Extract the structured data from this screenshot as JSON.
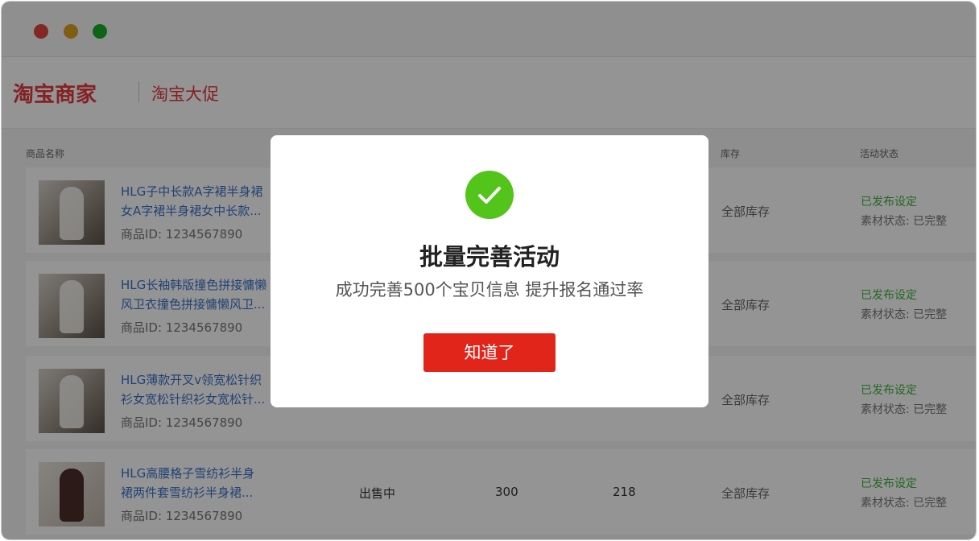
{
  "window": {
    "controls": [
      "close",
      "minimize",
      "maximize"
    ]
  },
  "brand": {
    "logo": "淘宝商家",
    "sub": "淘宝大促"
  },
  "table": {
    "headers": {
      "name": "商品名称",
      "stock": "库存",
      "status": "活动状态"
    },
    "rows": [
      {
        "title_line1": "HLG子中长款A字裙半身裙",
        "title_line2": "女A字裙半身裙女中长款...",
        "id": "商品ID: 1234567890",
        "stock": "全部库存",
        "status": "已发布设定",
        "material": "素材状态: 已完整"
      },
      {
        "title_line1": "HLG长袖韩版撞色拼接慵懒",
        "title_line2": "风卫衣撞色拼接慵懒风卫...",
        "id": "商品ID: 1234567890",
        "stock": "全部库存",
        "status": "已发布设定",
        "material": "素材状态: 已完整"
      },
      {
        "title_line1": "HLG薄款开叉v领宽松针织",
        "title_line2": "衫女宽松针织衫女宽松针...",
        "id": "商品ID: 1234567890",
        "stock": "全部库存",
        "status": "已发布设定",
        "material": "素材状态: 已完整"
      },
      {
        "title_line1": "HLG高腰格子雪纺衫半身",
        "title_line2": "裙两件套雪纺衫半身裙...",
        "id": "商品ID: 1234567890",
        "sale_status": "出售中",
        "qty": "300",
        "count": "218",
        "stock": "全部库存",
        "status": "已发布设定",
        "material": "素材状态: 已完整"
      }
    ]
  },
  "modal": {
    "icon": "check-icon",
    "title": "批量完善活动",
    "message": "成功完善500个宝贝信息 提升报名通过率",
    "button": "知道了"
  },
  "colors": {
    "brand_red": "#e4393c",
    "button_red": "#e1251b",
    "success_green": "#52c41a",
    "link_blue": "#3a74c9"
  }
}
